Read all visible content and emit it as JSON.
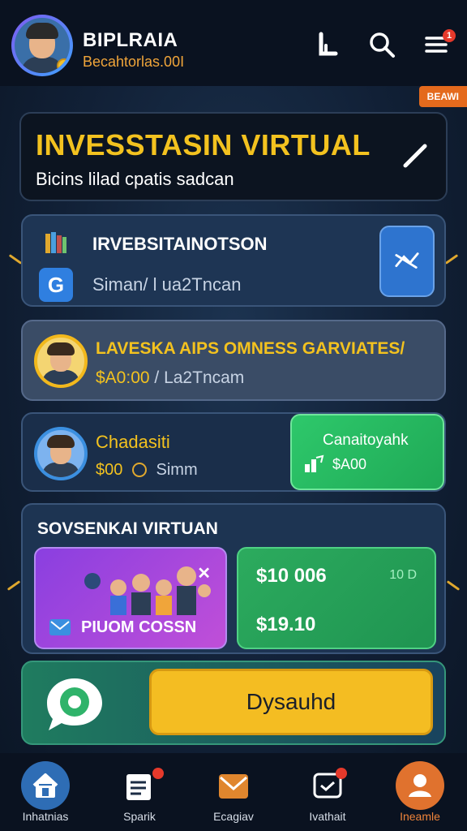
{
  "header": {
    "brand": "BIPLRAIA",
    "subtitle": "Becahtorlas.00I",
    "notif_count": "1"
  },
  "tag": "BEAWI",
  "title_card": {
    "title": "INVESSTASIN VIRTUAL",
    "subtitle": "Bicins lilad cpatis sadcan"
  },
  "cards": {
    "card1": {
      "label": "IRVEBSITAINOTSON",
      "sub": "Siman/ l ua2Tncan",
      "g_letter": "G"
    },
    "card2": {
      "title": "LAVESKA AIPS OMNESS GARVIATES/",
      "amount": "$A0:00",
      "sep": " / ",
      "sub": "La2Tncam"
    },
    "card3": {
      "name": "Chadasiti",
      "amount": "$00",
      "sub": "Simm",
      "cta_label": "Canaitoyahk",
      "cta_amount": "$A00"
    }
  },
  "panel": {
    "title": "SOVSENKAI VIRTUAN",
    "promo_label": "PIUOM COSSN",
    "balance_1": "$10 006",
    "balance_2": "$19.10",
    "balance_tag": "10 D"
  },
  "action": {
    "button_label": "Dysauhd"
  },
  "nav": [
    {
      "label": "Inhatnias",
      "icon": "home-icon"
    },
    {
      "label": "Sparik",
      "icon": "notes-icon",
      "badge": ""
    },
    {
      "label": "Ecagiav",
      "icon": "mail-icon"
    },
    {
      "label": "Ivathait",
      "icon": "chat-box-icon",
      "badge": ""
    },
    {
      "label": "Ineamle",
      "icon": "profile-icon"
    }
  ],
  "colors": {
    "accent_yellow": "#f3c21f",
    "accent_orange": "#f0843a",
    "green": "#2cab5e",
    "blue": "#2e74cf",
    "purple": "#8a3fe0",
    "background": "#0f1b2c"
  }
}
